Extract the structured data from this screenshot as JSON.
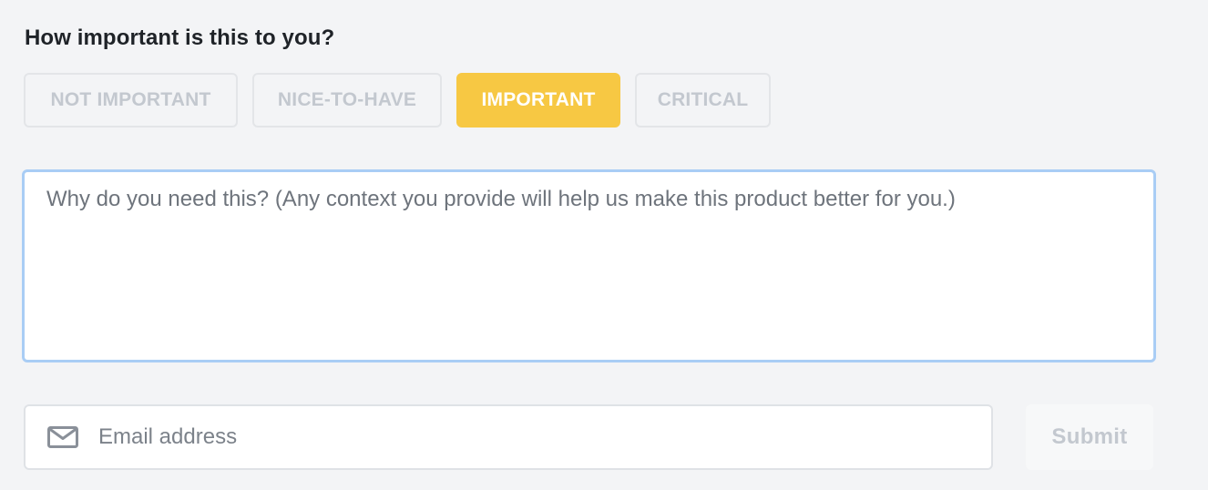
{
  "question": "How important is this to you?",
  "importance_options": [
    {
      "label": "NOT IMPORTANT",
      "selected": false
    },
    {
      "label": "NICE-TO-HAVE",
      "selected": false
    },
    {
      "label": "IMPORTANT",
      "selected": true
    },
    {
      "label": "CRITICAL",
      "selected": false
    }
  ],
  "context": {
    "placeholder": "Why do you need this? (Any context you provide will help us make this product better for you.)",
    "value": ""
  },
  "email": {
    "placeholder": "Email address",
    "value": "",
    "icon": "mail-icon"
  },
  "submit_label": "Submit",
  "colors": {
    "selected_accent": "#f7c843",
    "focus_border": "#a9cdf5",
    "muted_text": "#c3c8cf"
  }
}
